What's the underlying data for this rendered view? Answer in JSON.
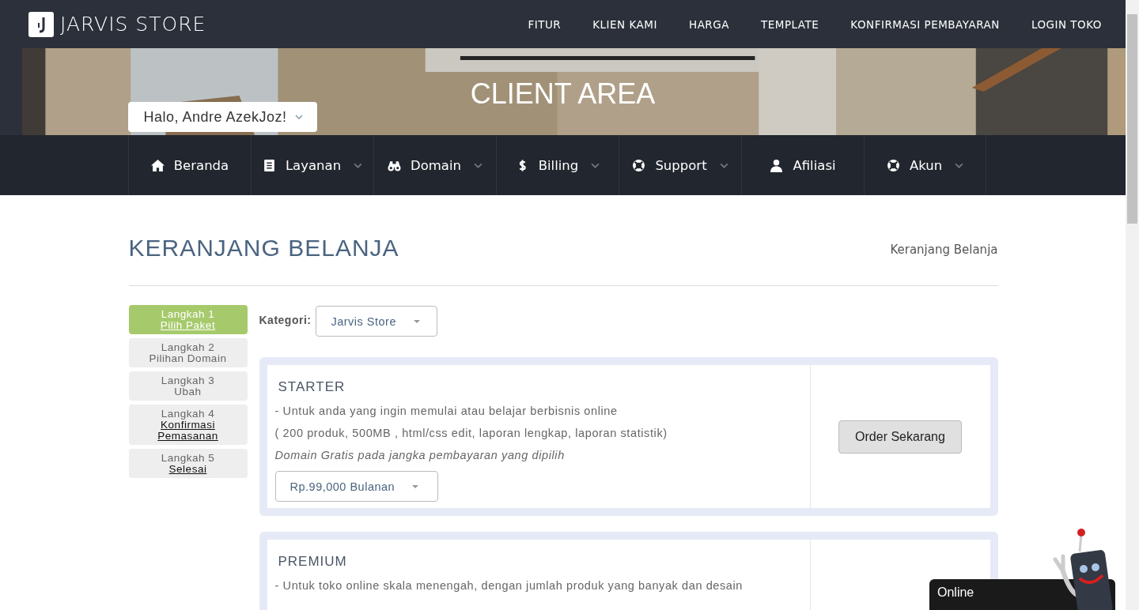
{
  "brand": "JARVIS STORE",
  "top_nav": [
    "FITUR",
    "KLIEN KAMI",
    "HARGA",
    "TEMPLATE",
    "KONFIRMASI PEMBAYARAN",
    "LOGIN TOKO"
  ],
  "hero": {
    "title": "CLIENT AREA",
    "user_menu": "Halo, Andre AzekJoz!"
  },
  "menu": [
    {
      "label": "Beranda",
      "kind": "home",
      "dropdown": false
    },
    {
      "label": "Layanan",
      "kind": "document",
      "dropdown": true
    },
    {
      "label": "Domain",
      "kind": "binoculars",
      "dropdown": true
    },
    {
      "label": "Billing",
      "kind": "dollar",
      "dropdown": true
    },
    {
      "label": "Support",
      "kind": "lifebuoy",
      "dropdown": true
    },
    {
      "label": "Afiliasi",
      "kind": "user",
      "dropdown": false
    },
    {
      "label": "Akun",
      "kind": "lifebuoy",
      "dropdown": true
    }
  ],
  "page": {
    "title": "KERANJANG BELANJA",
    "breadcrumb": "Keranjang Belanja"
  },
  "steps": [
    {
      "label": "Langkah 1",
      "name": "Pilih Paket",
      "selected": true,
      "linked": true
    },
    {
      "label": "Langkah 2",
      "name": "Pilihan Domain",
      "selected": false,
      "linked": false
    },
    {
      "label": "Langkah 3",
      "name": "Ubah",
      "selected": false,
      "linked": false
    },
    {
      "label": "Langkah 4",
      "name": "Konfirmasi Pemasanan",
      "selected": false,
      "linked": true
    },
    {
      "label": "Langkah 5",
      "name": "Selesai",
      "selected": false,
      "linked": true
    }
  ],
  "category": {
    "label": "Kategori:",
    "value": "Jarvis Store"
  },
  "products": [
    {
      "name": "STARTER",
      "lines": [
        "- Untuk anda yang ingin memulai atau belajar berbisnis online",
        "( 200 produk, 500MB , html/css edit, laporan lengkap, laporan statistik)"
      ],
      "note": "Domain Gratis pada jangka pembayaran yang dipilih",
      "price": "Rp.99,000 Bulanan",
      "button": "Order Sekarang"
    },
    {
      "name": "PREMIUM",
      "lines": [
        "- Untuk toko online skala menengah, dengan jumlah produk yang banyak dan desain"
      ]
    }
  ],
  "chat": {
    "label": "Online"
  }
}
